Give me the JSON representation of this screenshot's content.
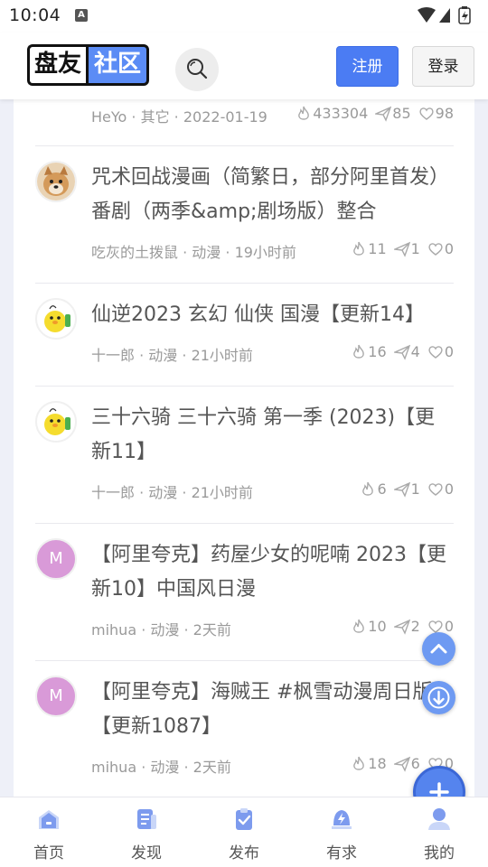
{
  "status_bar": {
    "time": "10:04",
    "notification_letter": "A"
  },
  "header": {
    "logo_left": "盘友",
    "logo_right": "社区",
    "register_label": "注册",
    "login_label": "登录"
  },
  "posts": [
    {
      "title": "",
      "author": "HeYo",
      "category": "其它",
      "time": "2022-01-19",
      "views": "433304",
      "shares": "85",
      "likes": "98",
      "avatar": "partial"
    },
    {
      "title": "咒术回战漫画（简繁日，部分阿里首发）番剧（两季&amp;剧场版）整合",
      "author": "吃灰的土拨鼠",
      "category": "动漫",
      "time": "19小时前",
      "views": "11",
      "shares": "1",
      "likes": "0",
      "avatar": "dog"
    },
    {
      "title": "仙逆2023 玄幻 仙侠 国漫【更新14】",
      "author": "十一郎",
      "category": "动漫",
      "time": "21小时前",
      "views": "16",
      "shares": "4",
      "likes": "0",
      "avatar": "chick"
    },
    {
      "title": "三十六骑 三十六骑 第一季 (2023)【更新11】",
      "author": "十一郎",
      "category": "动漫",
      "time": "21小时前",
      "views": "6",
      "shares": "1",
      "likes": "0",
      "avatar": "chick"
    },
    {
      "title": "【阿里夸克】药屋少女的呢喃 2023【更新10】中国风日漫",
      "author": "mihua",
      "category": "动漫",
      "time": "2天前",
      "views": "10",
      "shares": "2",
      "likes": "0",
      "avatar_letter": "M"
    },
    {
      "title": "【阿里夸克】海贼王 #枫雪动漫周日版 【更新1087】",
      "author": "mihua",
      "category": "动漫",
      "time": "2天前",
      "views": "18",
      "shares": "6",
      "likes": "0",
      "avatar_letter": "M"
    }
  ],
  "meta_separator": " · ",
  "bottom_nav": [
    {
      "label": "首页",
      "icon": "home-icon",
      "color": "#6f8fe8"
    },
    {
      "label": "发现",
      "icon": "discover-icon",
      "color": "#6f8fe8"
    },
    {
      "label": "发布",
      "icon": "publish-icon",
      "color": "#6f8fe8"
    },
    {
      "label": "有求",
      "icon": "request-icon",
      "color": "#6f8fe8"
    },
    {
      "label": "我的",
      "icon": "profile-icon",
      "color": "#6f8fe8"
    }
  ],
  "colors": {
    "accent": "#4b7cf3",
    "fab": "#6e9af2"
  }
}
